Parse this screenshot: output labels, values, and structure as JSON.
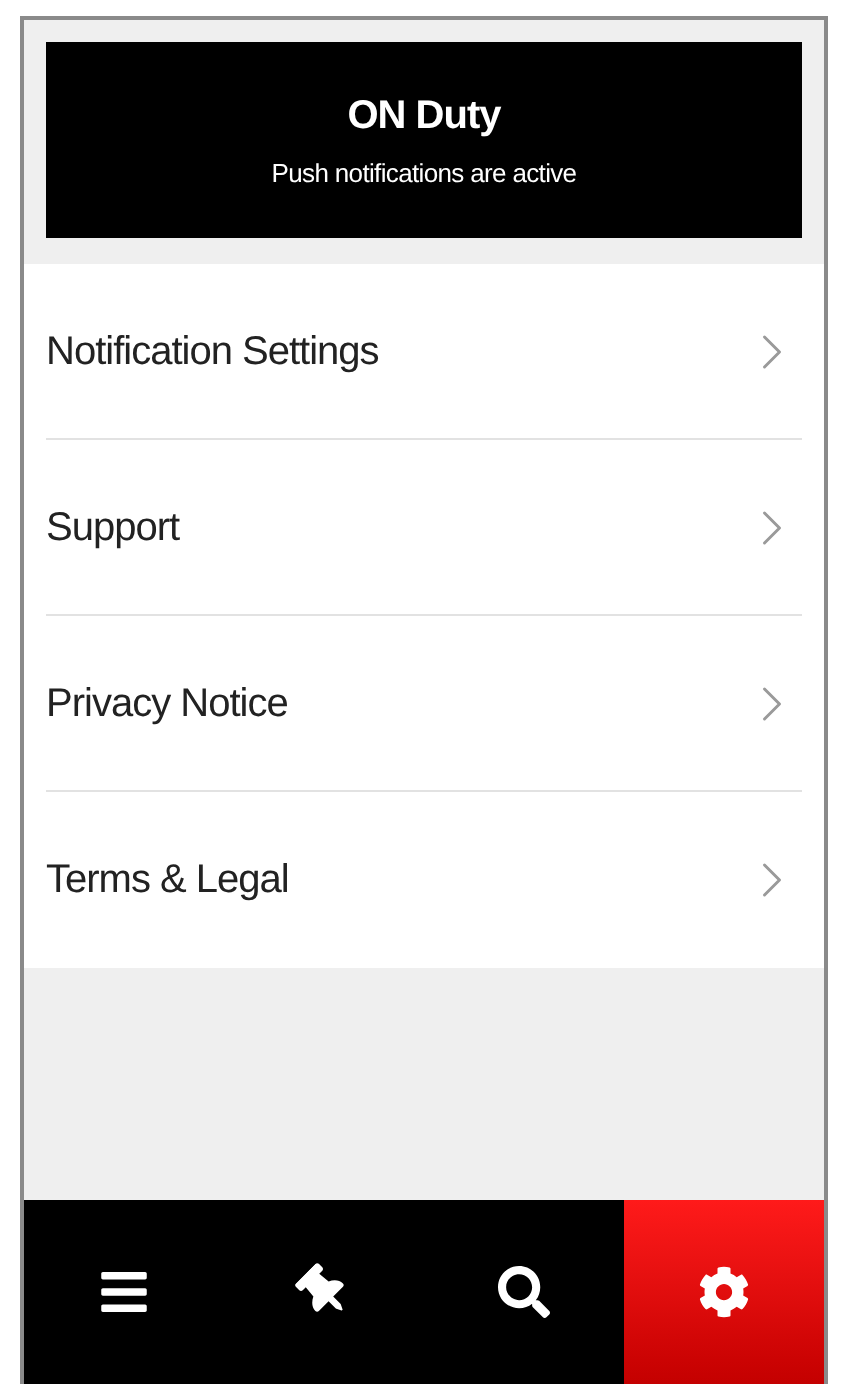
{
  "status": {
    "title": "ON Duty",
    "subtitle": "Push notifications are active"
  },
  "menu": [
    {
      "label": "Notification Settings"
    },
    {
      "label": "Support"
    },
    {
      "label": "Privacy Notice"
    },
    {
      "label": "Terms & Legal"
    }
  ],
  "nav": [
    {
      "kind": "menu",
      "selected": false
    },
    {
      "kind": "pin",
      "selected": false
    },
    {
      "kind": "search",
      "selected": false
    },
    {
      "kind": "settings",
      "selected": true
    }
  ]
}
